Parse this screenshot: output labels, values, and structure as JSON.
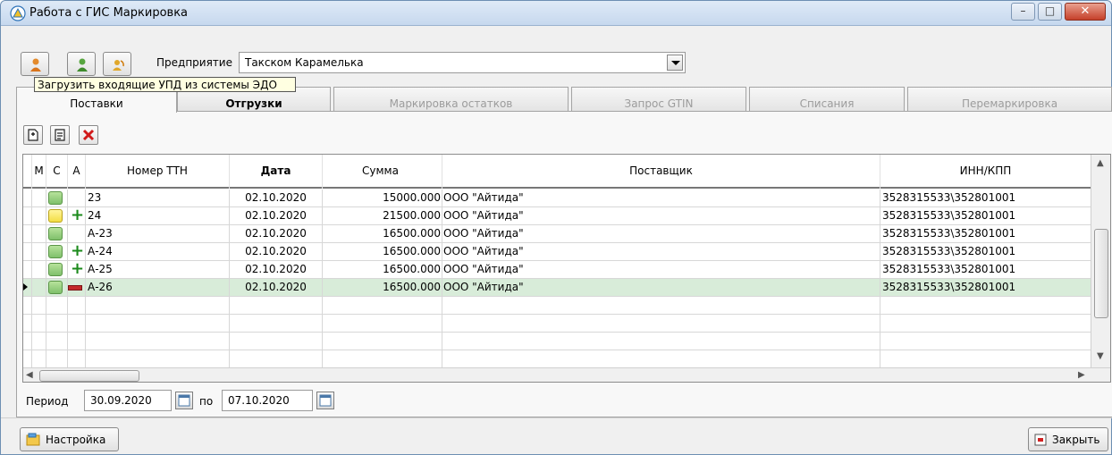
{
  "window": {
    "title": "Работа с ГИС Маркировка"
  },
  "toolbar": {
    "enterprise_label": "Предприятие",
    "enterprise_value": "Такском Карамелька",
    "tooltip": "Загрузить входящие УПД из системы ЭДО"
  },
  "tabs": [
    {
      "label": "Поставки",
      "state": "active"
    },
    {
      "label": "Отгрузки",
      "state": "enabled"
    },
    {
      "label": "Маркировка остатков",
      "state": "disabled"
    },
    {
      "label": "Запрос GTIN",
      "state": "disabled"
    },
    {
      "label": "Списания",
      "state": "disabled"
    },
    {
      "label": "Перемаркировка",
      "state": "disabled"
    }
  ],
  "grid": {
    "headers": {
      "m": "М",
      "c": "С",
      "a": "А",
      "ttn": "Номер ТТН",
      "date": "Дата",
      "sum": "Сумма",
      "supplier": "Поставщик",
      "inn": "ИНН/КПП"
    },
    "rows": [
      {
        "status": "green",
        "a": "",
        "ttn": "23",
        "date": "02.10.2020",
        "sum": "15000.000",
        "supplier": "ООО \"Айтида\"",
        "inn": "3528315533\\352801001",
        "selected": false
      },
      {
        "status": "yellow",
        "a": "plus",
        "ttn": "24",
        "date": "02.10.2020",
        "sum": "21500.000",
        "supplier": "ООО \"Айтида\"",
        "inn": "3528315533\\352801001",
        "selected": false
      },
      {
        "status": "green",
        "a": "",
        "ttn": "А-23",
        "date": "02.10.2020",
        "sum": "16500.000",
        "supplier": "ООО \"Айтида\"",
        "inn": "3528315533\\352801001",
        "selected": false
      },
      {
        "status": "green",
        "a": "plus",
        "ttn": "А-24",
        "date": "02.10.2020",
        "sum": "16500.000",
        "supplier": "ООО \"Айтида\"",
        "inn": "3528315533\\352801001",
        "selected": false
      },
      {
        "status": "green",
        "a": "plus",
        "ttn": "А-25",
        "date": "02.10.2020",
        "sum": "16500.000",
        "supplier": "ООО \"Айтида\"",
        "inn": "3528315533\\352801001",
        "selected": false
      },
      {
        "status": "green",
        "a": "redbar",
        "ttn": "А-26",
        "date": "02.10.2020",
        "sum": "16500.000",
        "supplier": "ООО \"Айтида\"",
        "inn": "3528315533\\352801001",
        "selected": true
      }
    ]
  },
  "period": {
    "label": "Период",
    "from": "30.09.2020",
    "to_label": "по",
    "to": "07.10.2020"
  },
  "footer": {
    "settings_label": "Настройка",
    "close_label": "Закрыть"
  },
  "colors": {
    "selected_row": "#d8ecd9",
    "status_green": "#8fcb77",
    "status_yellow": "#f6e56a",
    "plus_green": "#1b8a1b",
    "close_red": "#c5402a"
  }
}
